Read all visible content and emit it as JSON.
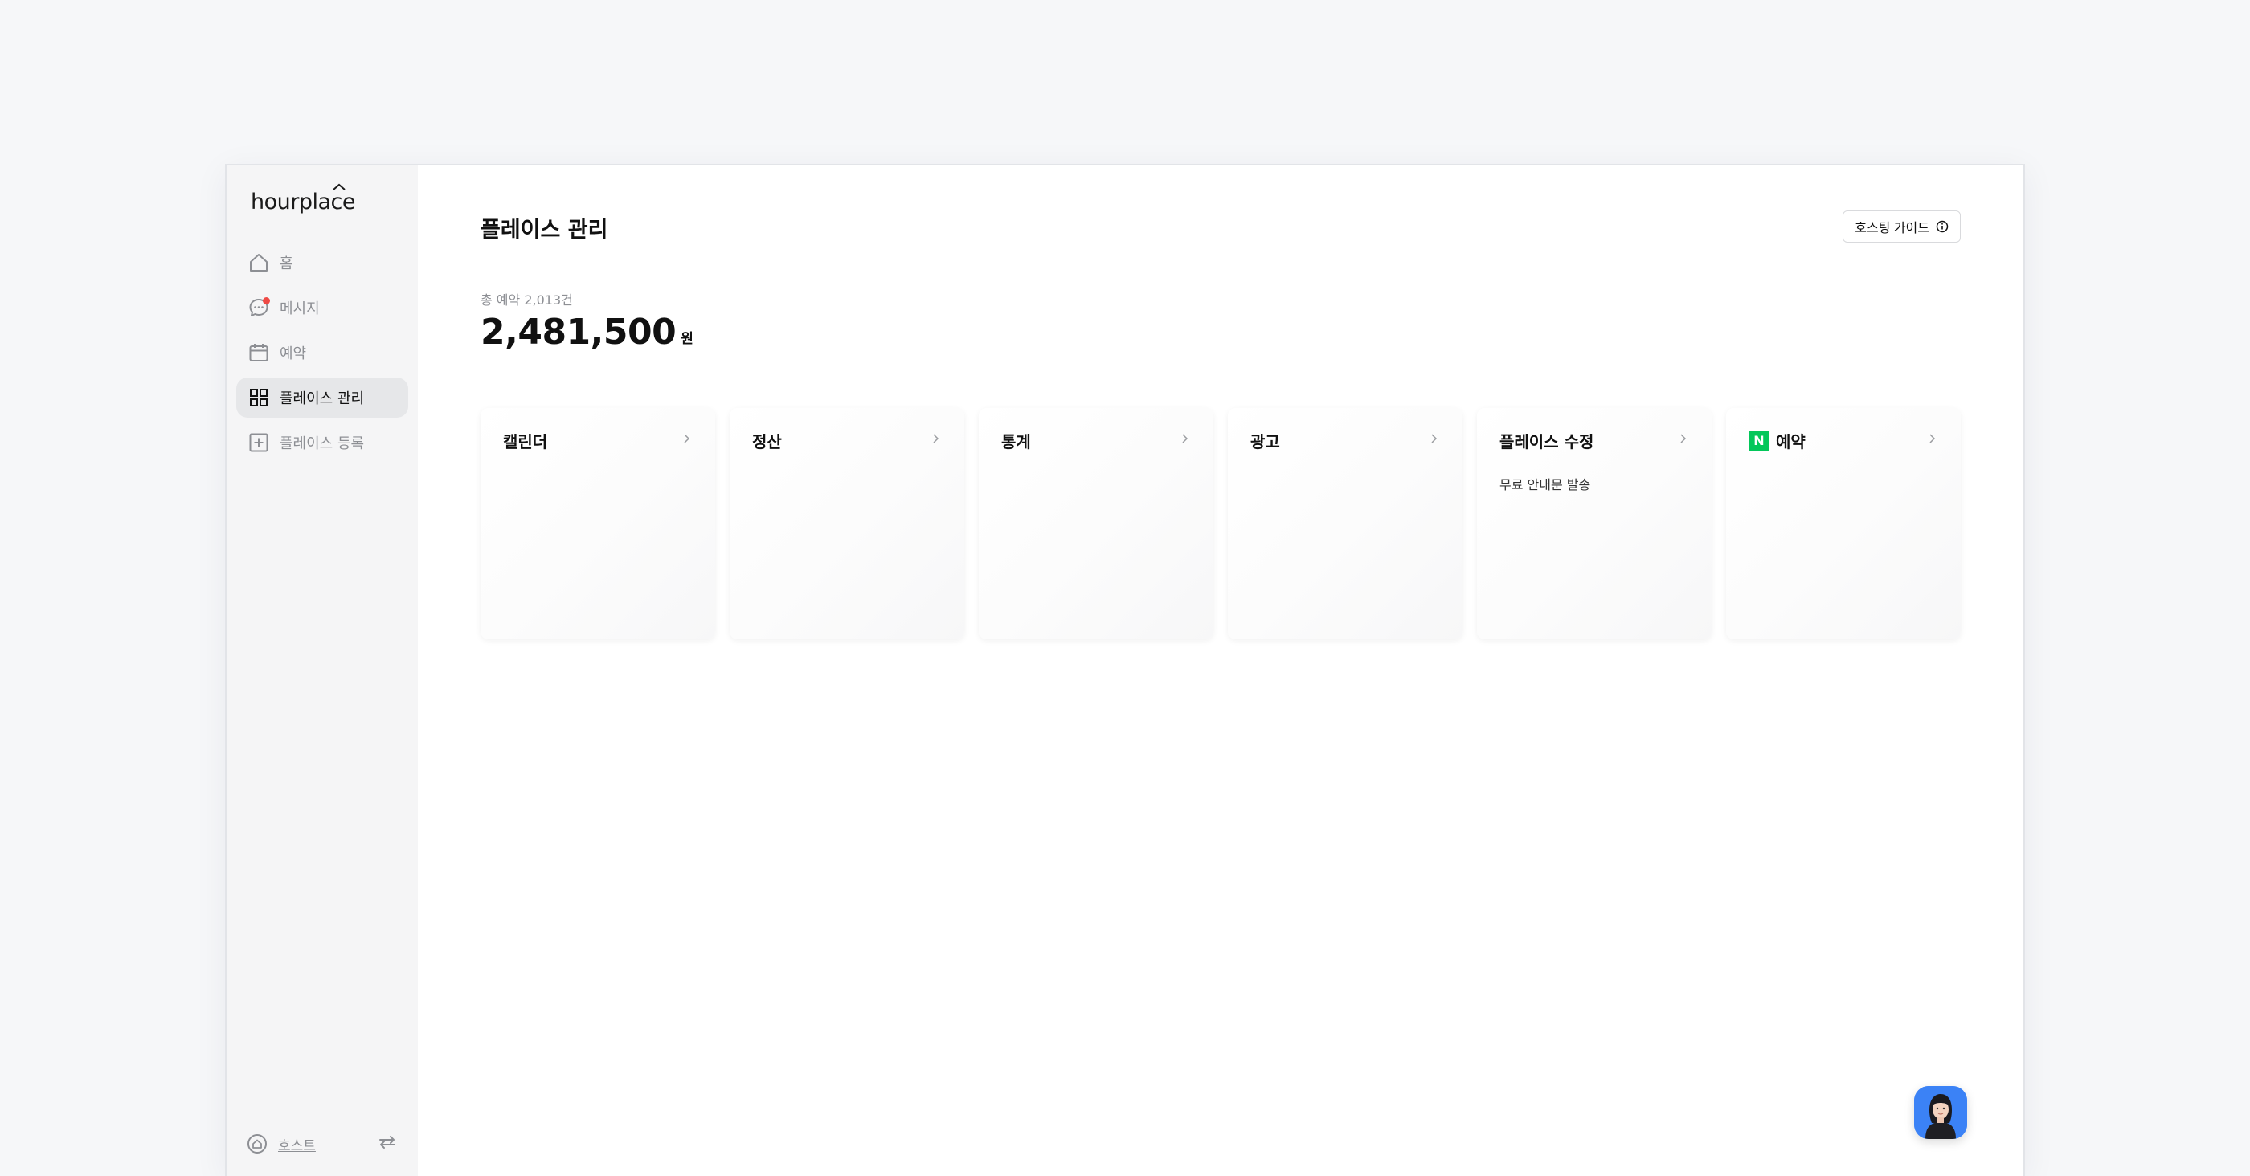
{
  "app": {
    "logo": "hourplace"
  },
  "sidebar": {
    "items": [
      {
        "label": "홈",
        "icon": "home-icon"
      },
      {
        "label": "메시지",
        "icon": "message-icon"
      },
      {
        "label": "예약",
        "icon": "calendar-icon"
      },
      {
        "label": "플레이스 관리",
        "icon": "grid-icon"
      },
      {
        "label": "플레이스 등록",
        "icon": "plus-square-icon"
      }
    ],
    "active_index": 3,
    "footer": {
      "mode_label": "호스트",
      "mode_icon": "house-circle-icon",
      "switch_icon": "swap-icon"
    }
  },
  "main": {
    "title": "플레이스 관리",
    "guide_button": "호스팅 가이드",
    "total_label": "총 예약 2,013건",
    "total_amount": "2,481,500",
    "total_unit": "원",
    "cards": [
      {
        "title": "캘린더",
        "subtitle": ""
      },
      {
        "title": "정산",
        "subtitle": ""
      },
      {
        "title": "통계",
        "subtitle": ""
      },
      {
        "title": "광고",
        "subtitle": ""
      },
      {
        "title": "플레이스 수정",
        "subtitle": "무료 안내문 발송"
      },
      {
        "title": "예약",
        "subtitle": "",
        "badge": "N"
      }
    ]
  },
  "colors": {
    "accent_naver": "#03c75a",
    "notification_dot": "#ef4a45",
    "chat_button": "#3b82f6"
  }
}
